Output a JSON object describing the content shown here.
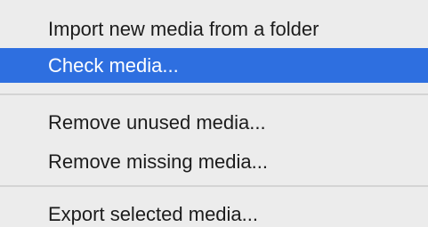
{
  "menu": {
    "items": [
      {
        "label": "Import new media from a folder"
      },
      {
        "label": "Check media..."
      },
      {
        "label": "Remove unused media..."
      },
      {
        "label": "Remove missing media..."
      },
      {
        "label": "Export selected media..."
      }
    ],
    "highlighted_item": "Check media..."
  },
  "colors": {
    "background": "#ececec",
    "highlight": "#2e6fe0",
    "highlight_text": "#ffffff",
    "text": "#1c1c1c",
    "separator": "#d4d4d4"
  }
}
